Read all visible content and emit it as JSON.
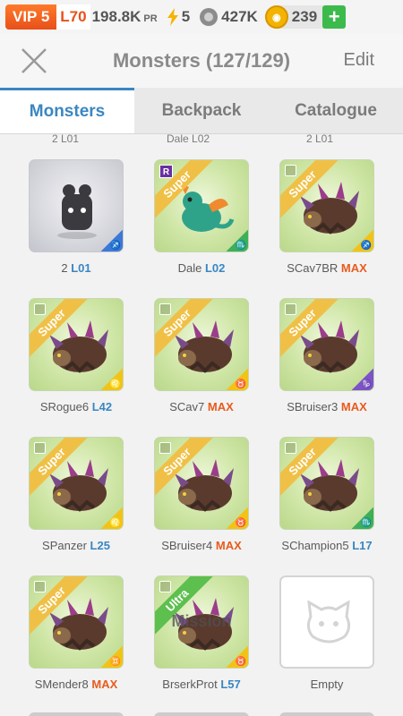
{
  "status": {
    "vip": "VIP 5",
    "level": "L70",
    "power": "198.8K",
    "power_unit": "PR",
    "energy": "5",
    "food": "427K",
    "gold": "239",
    "add_label": "+"
  },
  "header": {
    "title": "Monsters (127/129)",
    "edit": "Edit"
  },
  "tabs": [
    "Monsters",
    "Backpack",
    "Catalogue"
  ],
  "peek_labels": [
    "2 L01",
    "Dale L02",
    "2 L01"
  ],
  "monsters": [
    {
      "name": "2",
      "level": "L01",
      "sign": "♐",
      "sign_color": "blue",
      "ribbon": "",
      "card": "gray"
    },
    {
      "name": "Dale",
      "level": "L02",
      "sign": "♏",
      "sign_color": "green",
      "ribbon": "Super",
      "card": "green",
      "rarity_badge": "R"
    },
    {
      "name": "SCav7BR",
      "level": "MAX",
      "sign": "♐",
      "sign_color": "yellow",
      "ribbon": "Super",
      "card": "green"
    },
    {
      "name": "SRogue6",
      "level": "L42",
      "sign": "♌",
      "sign_color": "yellow",
      "ribbon": "Super",
      "card": "green"
    },
    {
      "name": "SCav7",
      "level": "MAX",
      "sign": "♉",
      "sign_color": "yellow",
      "ribbon": "Super",
      "card": "green"
    },
    {
      "name": "SBruiser3",
      "level": "MAX",
      "sign": "♑",
      "sign_color": "purple",
      "ribbon": "Super",
      "card": "green"
    },
    {
      "name": "SPanzer",
      "level": "L25",
      "sign": "♌",
      "sign_color": "yellow",
      "ribbon": "Super",
      "card": "green"
    },
    {
      "name": "SBruiser4",
      "level": "MAX",
      "sign": "♉",
      "sign_color": "yellow",
      "ribbon": "Super",
      "card": "green"
    },
    {
      "name": "SChampion5",
      "level": "L17",
      "sign": "♏",
      "sign_color": "green",
      "ribbon": "Super",
      "card": "green"
    },
    {
      "name": "SMender8",
      "level": "MAX",
      "sign": "♊",
      "sign_color": "yellow",
      "ribbon": "Super",
      "card": "green"
    },
    {
      "name": "BrserkProt",
      "level": "L57",
      "sign": "♉",
      "sign_color": "yellow",
      "ribbon": "Ultra",
      "card": "green",
      "overlay": "Mission"
    },
    {
      "name": "Empty",
      "level": "",
      "sign": "",
      "ribbon": "",
      "card": "empty"
    }
  ]
}
